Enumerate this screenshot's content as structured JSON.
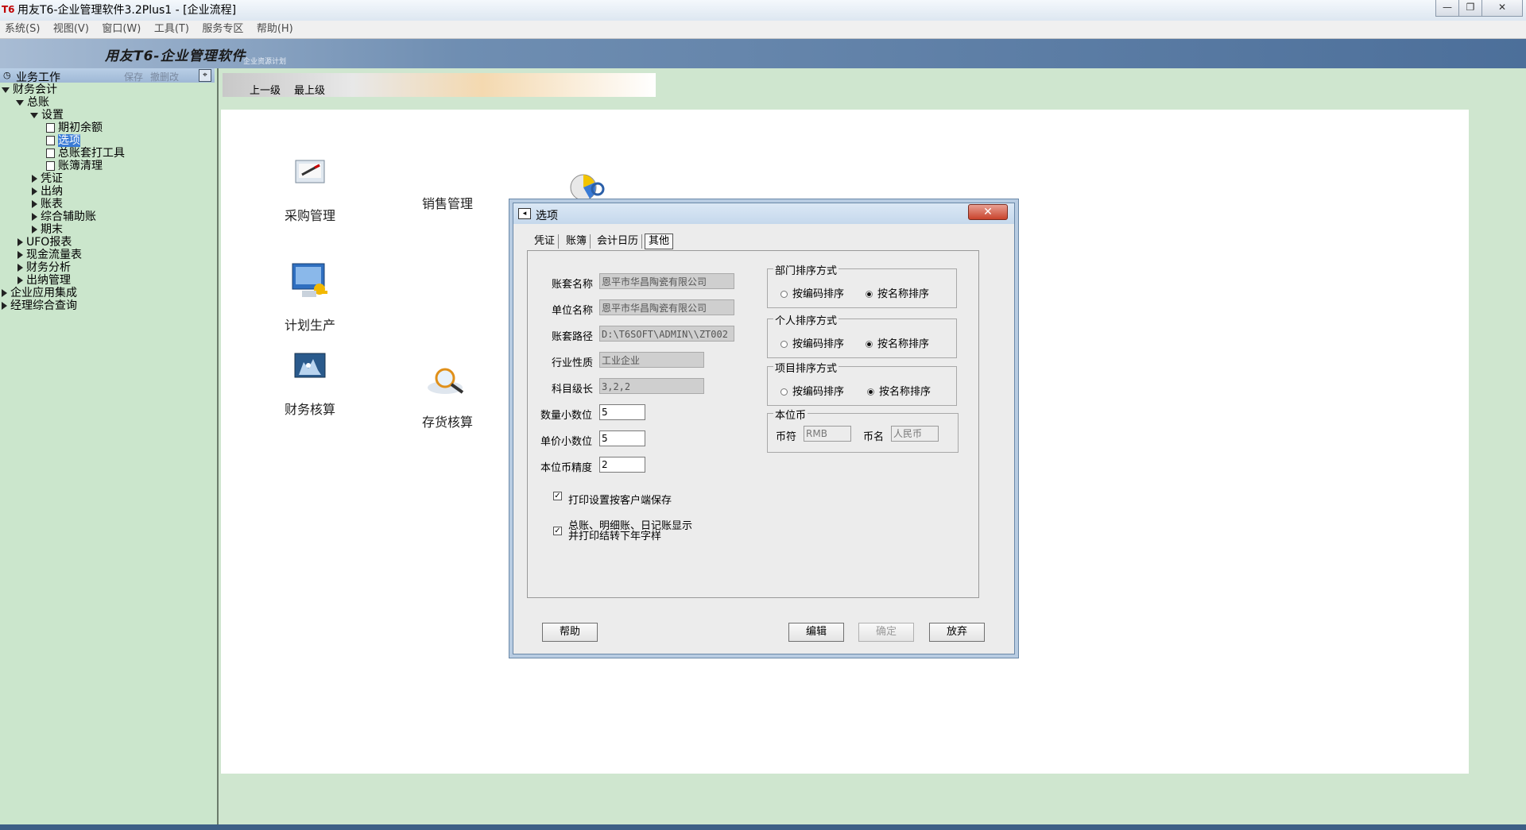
{
  "window": {
    "title": "用友T6-企业管理软件3.2Plus1  - [企业流程]",
    "logo": "T6",
    "buttons": [
      "—",
      "❐",
      "✕"
    ]
  },
  "menu": [
    "系统(S)",
    "视图(V)",
    "窗口(W)",
    "工具(T)",
    "服务专区",
    "帮助(H)"
  ],
  "banner": {
    "title": "用友T6-企业管理软件",
    "subtitle": "企业资源计划"
  },
  "leftpanel": {
    "header": "业务工作",
    "save": "保存",
    "cancel_change": "撤删改",
    "tree": {
      "finance": "财务会计",
      "gl": "总账",
      "setup": "设置",
      "opening": "期初余额",
      "options": "选项",
      "gl_tool": "总账套打工具",
      "ledger_clear": "账簿清理",
      "voucher": "凭证",
      "cashier": "出纳",
      "reports": "账表",
      "aux": "综合辅助账",
      "period_end": "期末",
      "ufo": "UFO报表",
      "cashflow": "现金流量表",
      "fin_analysis": "财务分析",
      "cash_mgmt": "出纳管理",
      "enterprise_int": "企业应用集成",
      "manager_query": "经理综合查询"
    }
  },
  "nav": {
    "up": "上一级",
    "top": "最上级"
  },
  "modules": {
    "purchase": "采购管理",
    "sales": "销售管理",
    "planning": "计划生产",
    "fin_acct": "财务核算",
    "inventory": "存货核算"
  },
  "dialog": {
    "title": "选项",
    "close": "✕",
    "tabs": [
      "凭证",
      "账簿",
      "会计日历",
      "其他"
    ],
    "fields": {
      "set_name_label": "账套名称",
      "set_name": "恩平市华昌陶瓷有限公司",
      "unit_name_label": "单位名称",
      "unit_name": "恩平市华昌陶瓷有限公司",
      "path_label": "账套路径",
      "path": "D:\\T6SOFT\\ADMIN\\\\ZT002",
      "industry_label": "行业性质",
      "industry": "工业企业",
      "subject_len_label": "科目级长",
      "subject_len": "3,2,2",
      "qty_dec_label": "数量小数位",
      "qty_dec": "5",
      "price_dec_label": "单价小数位",
      "price_dec": "5",
      "currency_prec_label": "本位币精度",
      "currency_prec": "2"
    },
    "checks": {
      "print_client": "打印设置按客户端保存",
      "carry_line1": "总账、明细账、日记账显示",
      "carry_line2": "并打印结转下年字样"
    },
    "groups": {
      "dept": "部门排序方式",
      "person": "个人排序方式",
      "project": "项目排序方式",
      "local_currency": "本位币",
      "by_code": "按编码排序",
      "by_name": "按名称排序",
      "symbol_label": "币符",
      "symbol": "RMB",
      "cname_label": "币名",
      "cname": "人民币"
    },
    "buttons": {
      "help": "帮助",
      "edit": "编辑",
      "ok": "确定",
      "cancel": "放弃"
    }
  },
  "colors": {
    "accent": "#3a7bd5",
    "left_bg": "#cbe6cc",
    "close_red": "#c9432c"
  }
}
